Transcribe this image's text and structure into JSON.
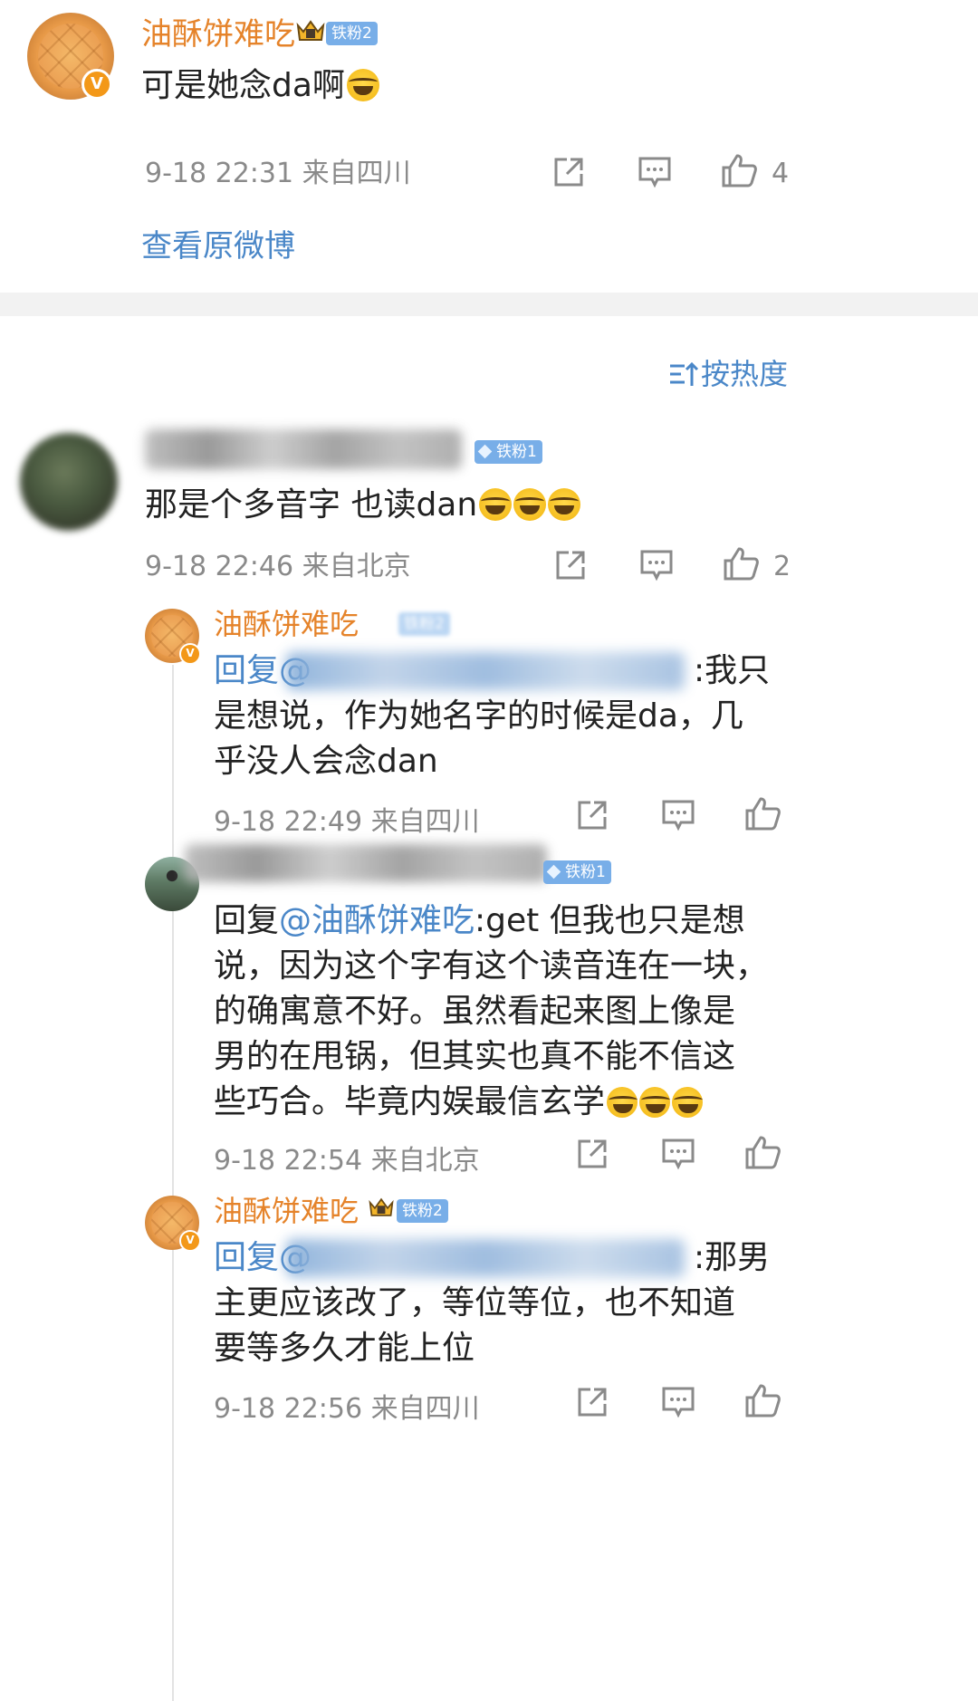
{
  "top_post": {
    "username": "油酥饼难吃",
    "badge": "铁粉2",
    "verified_mark": "V",
    "content": "可是她念da啊",
    "timestamp": "9-18 22:31 来自四川",
    "like_count": "4",
    "view_original": "查看原微博"
  },
  "sort": {
    "label": "按热度"
  },
  "comments": [
    {
      "badge": "铁粉1",
      "content": "那是个多音字 也读dan",
      "timestamp": "9-18 22:46 来自北京",
      "like_count": "2",
      "replies": [
        {
          "username": "油酥饼难吃",
          "badge": "铁粉2",
          "reply_prefix": "回复@",
          "content_line1": ":我只",
          "content_line2": "是想说，作为她名字的时候是da，几",
          "content_line3": "乎没人会念dan",
          "timestamp": "9-18 22:49 来自四川"
        },
        {
          "badge": "铁粉1",
          "reply_prefix": "回复",
          "mention": "@油酥饼难吃",
          "content_line1": ":get  但我也只是想",
          "content_line2": "说，因为这个字有这个读音连在一块，",
          "content_line3": "的确寓意不好。虽然看起来图上像是",
          "content_line4": "男的在甩锅，但其实也真不能不信这",
          "content_line5": "些巧合。毕竟内娱最信玄学",
          "timestamp": "9-18 22:54 来自北京"
        },
        {
          "username": "油酥饼难吃",
          "badge": "铁粉2",
          "reply_prefix": "回复@",
          "content_line1": ":那男",
          "content_line2": "主更应该改了，等位等位，也不知道",
          "content_line3": "要等多久才能上位",
          "timestamp": "9-18 22:56 来自四川"
        }
      ]
    }
  ],
  "icons": {
    "share": "share-icon",
    "comment": "comment-icon",
    "like": "like-icon",
    "sort": "sort-icon",
    "emoji": "laugh-cry-emoji"
  },
  "colors": {
    "username": "#e5832a",
    "link": "#4a87c8",
    "badge": "#78aee8",
    "meta": "#8a8a8a",
    "divider": "#f2f2f2"
  }
}
